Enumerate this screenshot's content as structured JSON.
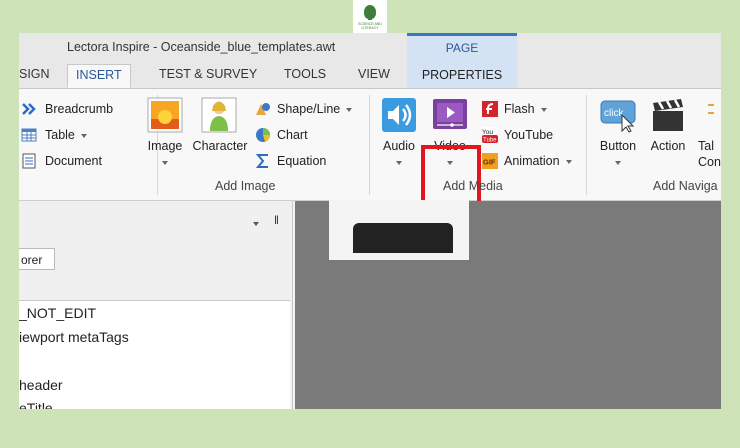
{
  "brand": {
    "logo_text": "SCIENCE AND LITERACY"
  },
  "window": {
    "title": "Lectora Inspire - Oceanside_blue_templates.awt",
    "context_tab": "PAGE"
  },
  "tabs": [
    {
      "label": "SIGN"
    },
    {
      "label": "INSERT"
    },
    {
      "label": "TEST & SURVEY"
    },
    {
      "label": "TOOLS"
    },
    {
      "label": "VIEW"
    },
    {
      "label": "PROPERTIES"
    }
  ],
  "ribbon": {
    "nav_small": [
      {
        "label": "Breadcrumb",
        "icon": "breadcrumb-icon"
      },
      {
        "label": "Table",
        "icon": "table-icon"
      },
      {
        "label": "Document",
        "icon": "document-icon"
      }
    ],
    "add_image": {
      "label": "Add Image",
      "image": "Image",
      "character": "Character",
      "small": [
        {
          "label": "Shape/Line",
          "icon": "shapes-icon"
        },
        {
          "label": "Chart",
          "icon": "chart-icon"
        },
        {
          "label": "Equation",
          "icon": "equation-icon"
        }
      ]
    },
    "add_media": {
      "label": "Add Media",
      "audio": "Audio",
      "video": "Video",
      "small": [
        {
          "label": "Flash",
          "icon": "flash-icon"
        },
        {
          "label": "YouTube",
          "icon": "youtube-icon"
        },
        {
          "label": "Animation",
          "icon": "gif-icon"
        }
      ]
    },
    "add_navigation": {
      "label": "Add Naviga",
      "button": "Button",
      "action": "Action",
      "tab_line1": "Tal",
      "tab_line2": "Con"
    },
    "highlight_color": "#e3151e"
  },
  "left_pane": {
    "pin": "‖",
    "tab_label": "orer",
    "tree": [
      "_NOT_EDIT",
      "iewport metaTags",
      "",
      "header",
      "eTitle"
    ]
  },
  "colors": {
    "background": "#cfe3b8",
    "accent": "#2b5797",
    "stage": "#7a7a7a"
  }
}
